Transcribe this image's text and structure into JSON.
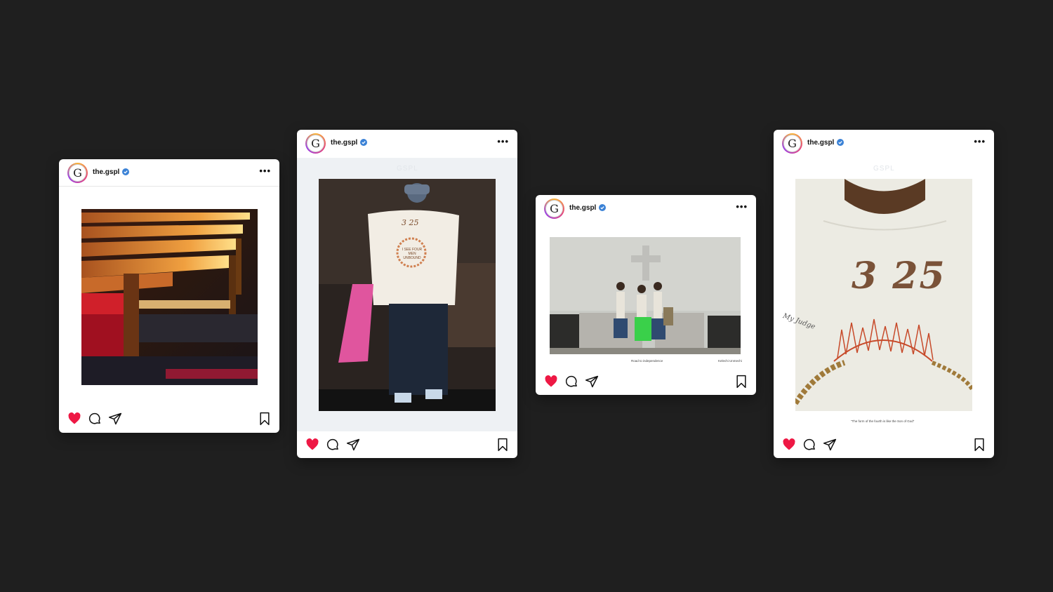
{
  "username": "the.gspl",
  "avatar_letter": "G",
  "colors": {
    "background": "#1f1f1f",
    "heart": "#ee1844",
    "verified": "#3b82d6"
  },
  "icons": [
    "heart-icon",
    "comment-icon",
    "share-icon",
    "bookmark-icon",
    "more-icon",
    "verified-badge-icon"
  ],
  "post2": {
    "watermark": "GSPL",
    "shirt_number": "3 25",
    "shirt_text": "I SEE FOUR MEN UNBOUND"
  },
  "post3": {
    "caption_left": "Road to independence",
    "caption_right": "Kelechi Unmechi"
  },
  "post4": {
    "watermark": "GSPL",
    "shirt_number": "3 25",
    "handwriting": "My Judge",
    "quote": "“The form of the fourth is like the Son of God”"
  }
}
